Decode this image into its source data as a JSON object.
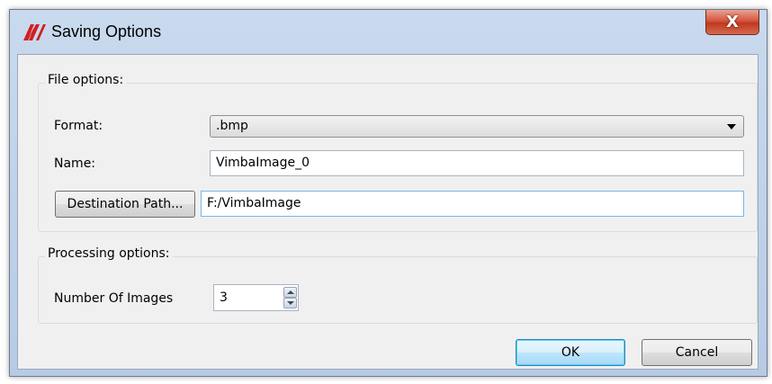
{
  "window": {
    "title": "Saving Options",
    "app_icon": "vimba-logo-icon",
    "close_label": "X",
    "brand_color": "#d11f1f"
  },
  "file_options": {
    "title": "File options:",
    "format_label": "Format:",
    "format_value": ".bmp",
    "name_label": "Name:",
    "name_value": "VimbaImage_0",
    "destination_button": "Destination Path...",
    "destination_value": "F:/VimbaImage"
  },
  "processing_options": {
    "title": "Processing options:",
    "number_label": "Number Of Images",
    "number_value": "3"
  },
  "buttons": {
    "ok": "OK",
    "cancel": "Cancel"
  }
}
